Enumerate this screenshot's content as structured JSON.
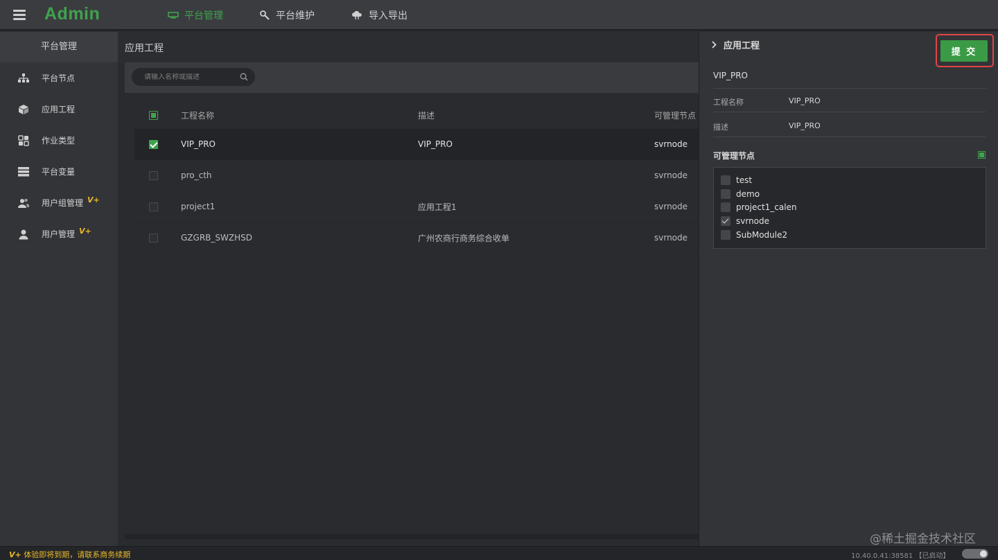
{
  "app": {
    "logo": "Admin"
  },
  "topnav": [
    {
      "label": "平台管理",
      "icon": "monitor-icon",
      "active": true
    },
    {
      "label": "平台维护",
      "icon": "wrench-icon",
      "active": false
    },
    {
      "label": "导入导出",
      "icon": "cloud-transfer-icon",
      "active": false
    }
  ],
  "sidebar": {
    "header": "平台管理",
    "items": [
      {
        "label": "平台节点",
        "icon": "node-tree-icon",
        "vplus": ""
      },
      {
        "label": "应用工程",
        "icon": "cube-icon",
        "vplus": ""
      },
      {
        "label": "作业类型",
        "icon": "grid-icon",
        "vplus": ""
      },
      {
        "label": "平台变量",
        "icon": "server-stack-icon",
        "vplus": ""
      },
      {
        "label": "用户组管理",
        "icon": "user-group-icon",
        "vplus": "V+"
      },
      {
        "label": "用户管理",
        "icon": "user-icon",
        "vplus": "V+"
      }
    ]
  },
  "main": {
    "title": "应用工程",
    "search": {
      "placeholder": "请输入名称或描述",
      "value": ""
    },
    "columns": {
      "name": "工程名称",
      "desc": "描述",
      "node": "可管理节点"
    },
    "rows": [
      {
        "name": "VIP_PRO",
        "desc": "VIP_PRO",
        "node": "svrnode",
        "checked": true
      },
      {
        "name": "pro_cth",
        "desc": "",
        "node": "svrnode",
        "checked": false
      },
      {
        "name": "project1",
        "desc": "应用工程1",
        "node": "svrnode",
        "checked": false
      },
      {
        "name": "GZGRB_SWZHSD",
        "desc": "广州农商行商务综合收单",
        "node": "svrnode",
        "checked": false
      }
    ]
  },
  "panel": {
    "title": "应用工程",
    "submit_label": "提 交",
    "project": "VIP_PRO",
    "fields": [
      {
        "label": "工程名称",
        "value": "VIP_PRO"
      },
      {
        "label": "描述",
        "value": "VIP_PRO"
      }
    ],
    "nodes_title": "可管理节点",
    "nodes": [
      {
        "label": "test",
        "checked": false
      },
      {
        "label": "demo",
        "checked": false
      },
      {
        "label": "project1_calen",
        "checked": false
      },
      {
        "label": "svrnode",
        "checked": true
      },
      {
        "label": "SubModule2",
        "checked": false
      }
    ]
  },
  "watermark": "@稀土掘金技术社区",
  "footer": {
    "warning_vplus": "V+",
    "warning": " 体验即将到期，请联系商务续期",
    "address": "10.40.0.41:38581 【已启动】"
  },
  "colors": {
    "accent": "#3fa34d",
    "warning": "#e8b92c",
    "highlight": "#e04545"
  }
}
